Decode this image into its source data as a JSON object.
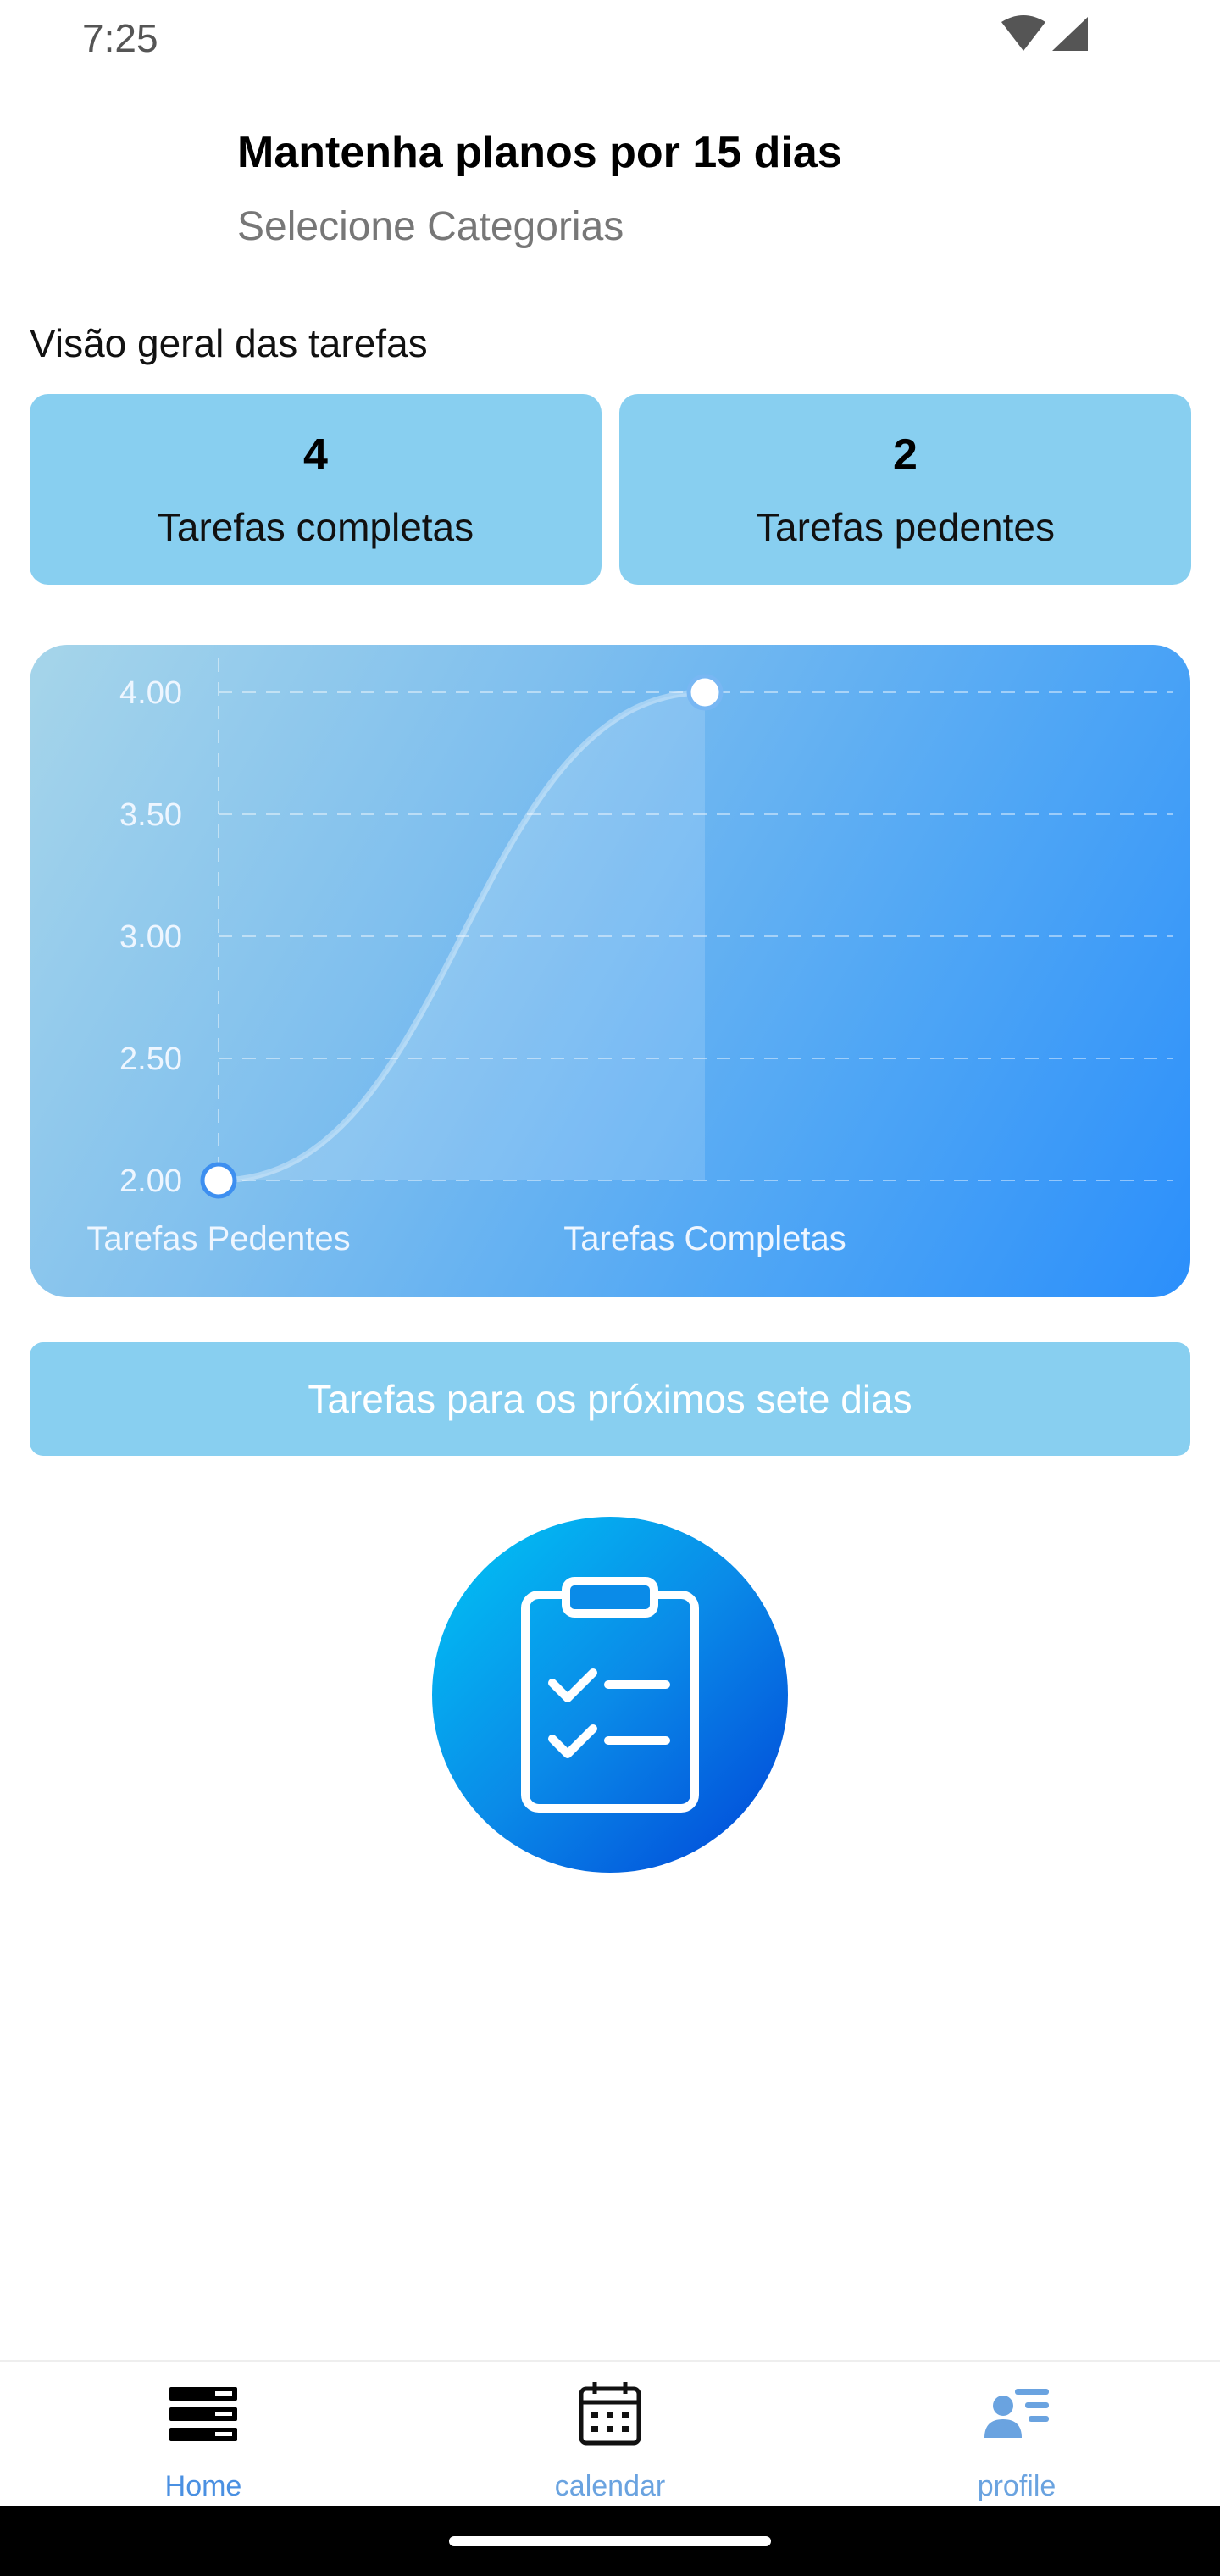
{
  "status_bar": {
    "time": "7:25",
    "icons": [
      "wifi-icon",
      "signal-icon"
    ]
  },
  "header": {
    "title": "Mantenha planos por 15 dias",
    "subtitle": "Selecione Categorias"
  },
  "overview": {
    "label": "Visão geral das tarefas",
    "completed": {
      "value": "4",
      "label": "Tarefas completas"
    },
    "pending": {
      "value": "2",
      "label": "Tarefas pedentes"
    }
  },
  "chart_data": {
    "type": "area",
    "categories": [
      "Tarefas Pedentes",
      "Tarefas Completas"
    ],
    "values": [
      2,
      4
    ],
    "y_ticks": [
      "4.00",
      "3.50",
      "3.00",
      "2.50",
      "2.00"
    ],
    "ylim": [
      2,
      4
    ],
    "grid": true,
    "line_color": "#ffffff"
  },
  "next_days_button": {
    "label": "Tarefas para os próximos sete dias"
  },
  "fab": {
    "icon": "clipboard-checklist-icon"
  },
  "bottom_nav": {
    "items": [
      {
        "label": "Home",
        "icon": "home-list-icon",
        "active": true
      },
      {
        "label": "calendar",
        "icon": "calendar-icon",
        "active": false
      },
      {
        "label": "profile",
        "icon": "profile-list-icon",
        "active": false
      }
    ]
  },
  "colors": {
    "card_bg": "#88cff0",
    "accent": "#4a90e2",
    "nav_active_label": "#4a90e2",
    "nav_inactive_label": "#6aa3e0"
  }
}
